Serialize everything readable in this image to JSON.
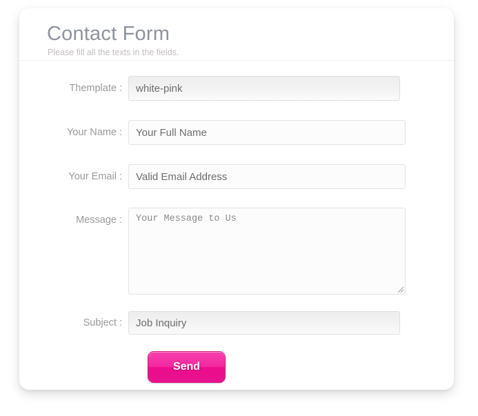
{
  "card": {
    "header": {
      "title": "Contact Form",
      "subtitle": "Please fill all the texts in the fields."
    }
  },
  "form": {
    "fields": [
      {
        "key": "themplate",
        "label": "Themplate :",
        "value": "white-pink",
        "placeholder": "white-pink",
        "type": "text",
        "readonly": true
      },
      {
        "key": "your_name",
        "label": "Your Name :",
        "value": "",
        "placeholder": "Your Full Name",
        "type": "text",
        "readonly": false
      },
      {
        "key": "your_email",
        "label": "Your Email :",
        "value": "",
        "placeholder": "Valid Email Address",
        "type": "text",
        "readonly": false
      },
      {
        "key": "message",
        "label": "Message :",
        "value": "",
        "placeholder": "Your Message to Us",
        "type": "textarea",
        "readonly": false
      },
      {
        "key": "subject",
        "label": "Subject :",
        "value": "Job Inquiry",
        "placeholder": "Job Inquiry",
        "type": "text",
        "readonly": true
      }
    ],
    "submit_label": "Send"
  },
  "colors": {
    "accent_pink": "#ec0c8c",
    "accent_pink_light": "#f73fad",
    "title_grey": "#8e939e",
    "subtitle_grey": "#c3bdbd",
    "label_grey": "#9a9a9a",
    "input_text": "#6d6d6d",
    "card_background": "#ffffff",
    "page_background": "#ffffff"
  },
  "icons": {
    "resize_grip": "resize-grip-icon"
  }
}
